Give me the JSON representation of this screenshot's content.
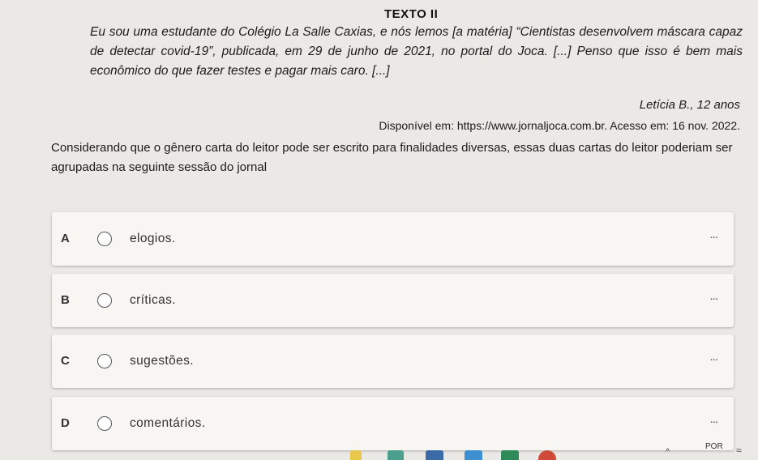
{
  "text_title": "TEXTO II",
  "quote": "Eu sou uma estudante do Colégio La Salle Caxias, e nós lemos [a matéria] “Cientistas desenvolvem máscara capaz de detectar covid-19”, publicada, em 29 de junho de 2021, no portal do Joca. [...] Penso que isso é bem mais econômico do que fazer testes e pagar mais caro. [...]",
  "author": "Letícia B., 12 anos",
  "source": "Disponível em: https://www.jornaljoca.com.br. Acesso em: 16 nov. 2022.",
  "question": "Considerando que o gênero carta do leitor pode ser escrito para finalidades diversas, essas duas cartas do leitor poderiam ser agrupadas na seguinte sessão do jornal",
  "options": [
    {
      "letter": "A",
      "label": "elogios.",
      "more": "..."
    },
    {
      "letter": "B",
      "label": "críticas.",
      "more": "..."
    },
    {
      "letter": "C",
      "label": "sugestões.",
      "more": "..."
    },
    {
      "letter": "D",
      "label": "comentários.",
      "more": "..."
    }
  ],
  "taskbar": {
    "caret": "^",
    "language": "POR",
    "wifi_icon": "wifi-icon"
  },
  "colors": {
    "background": "#ebe9e5",
    "option_card": "#f7f6f3"
  }
}
